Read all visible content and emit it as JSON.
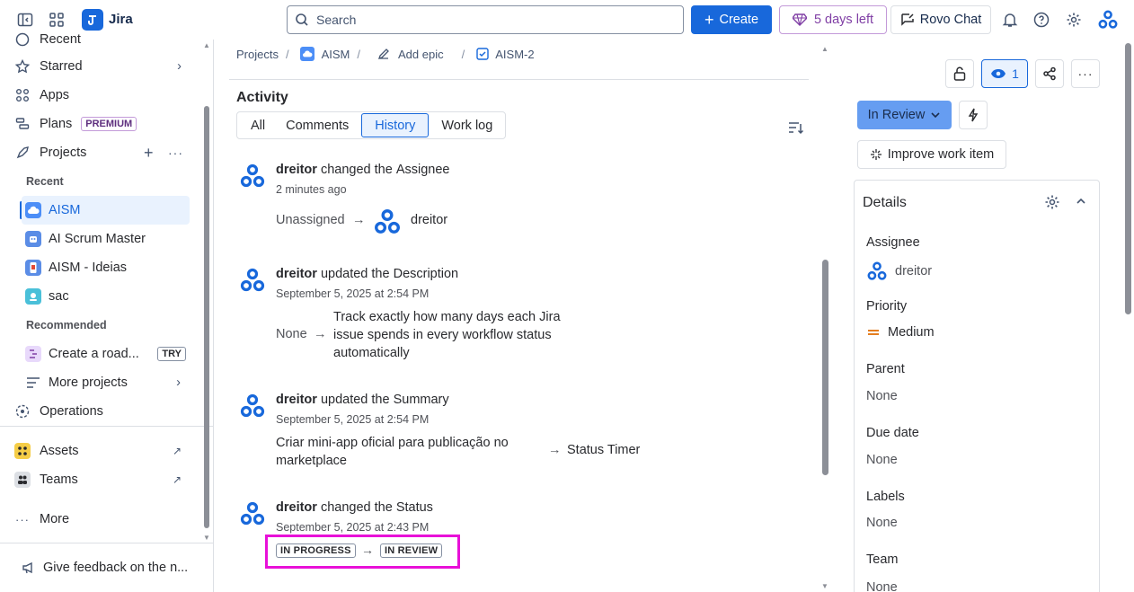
{
  "app": {
    "name": "Jira"
  },
  "topbar": {
    "search_placeholder": "Search",
    "create_label": "Create",
    "trial_label": "5 days left",
    "rovo_label": "Rovo Chat"
  },
  "sidebar": {
    "partial_top_label": "Recent",
    "starred": "Starred",
    "apps": "Apps",
    "plans": "Plans",
    "plans_badge": "PREMIUM",
    "projects": "Projects",
    "recent_header": "Recent",
    "recent_projects": [
      "AISM",
      "AI Scrum Master",
      "AISM - Ideias",
      "sac"
    ],
    "recommended_header": "Recommended",
    "recommended_item": "Create a road...",
    "recommended_badge": "TRY",
    "more_projects": "More projects",
    "operations": "Operations",
    "assets": "Assets",
    "teams": "Teams",
    "more": "More",
    "feedback": "Give feedback on the n..."
  },
  "breadcrumb": {
    "projects": "Projects",
    "project": "AISM",
    "epic": "Add epic",
    "issue": "AISM-2"
  },
  "activity": {
    "title": "Activity",
    "tabs": [
      "All",
      "Comments",
      "History",
      "Work log"
    ],
    "active_tab": "History",
    "entries": [
      {
        "user": "dreitor",
        "action": "changed the",
        "field": "Assignee",
        "time": "2 minutes ago",
        "from": "Unassigned",
        "to": "dreitor"
      },
      {
        "user": "dreitor",
        "action": "updated the",
        "field": "Description",
        "time": "September 5, 2025 at 2:54 PM",
        "from": "None",
        "to_lines": [
          "Track exactly how many days each Jira",
          "issue spends in every workflow status",
          "automatically"
        ]
      },
      {
        "user": "dreitor",
        "action": "updated the",
        "field": "Summary",
        "time": "September 5, 2025 at 2:54 PM",
        "from_lines": [
          "Criar mini-app oficial para publicação no",
          "marketplace"
        ],
        "to": "Status Timer"
      },
      {
        "user": "dreitor",
        "action": "changed the",
        "field": "Status",
        "time": "September 5, 2025 at 2:43 PM",
        "from": "IN PROGRESS",
        "to": "IN REVIEW"
      }
    ],
    "arrow": "→"
  },
  "right_panel": {
    "watch_count": "1",
    "status": "In Review",
    "improve": "Improve work item",
    "details_title": "Details",
    "fields": [
      {
        "label": "Assignee",
        "value": "dreitor"
      },
      {
        "label": "Priority",
        "value": "Medium"
      },
      {
        "label": "Parent",
        "value": "None"
      },
      {
        "label": "Due date",
        "value": "None"
      },
      {
        "label": "Labels",
        "value": "None"
      },
      {
        "label": "Team",
        "value": "None"
      }
    ]
  },
  "colors": {
    "brand": "#1868db",
    "highlight": "#e810d8",
    "status": "#669df1"
  }
}
